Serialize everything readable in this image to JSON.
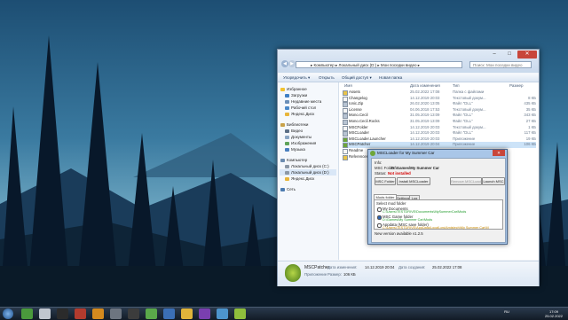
{
  "explorer": {
    "breadcrumb": "▸ Компьютер ▸ Локальный диск (D:) ▸ Мои поседки видео ▸",
    "search_placeholder": "Поиск: Мои поседки видео",
    "toolbar": [
      "Упорядочить ▾",
      "Открыть",
      "Общий доступ ▾",
      "Новая папка"
    ],
    "nav": {
      "favorites": "Избранное",
      "downloads": "Загрузки",
      "recent": "Недавние места",
      "desktop": "Рабочий стол",
      "yandex": "Яндекс.Диск",
      "libraries": "Библиотеки",
      "video": "Видео",
      "documents": "Документы",
      "images": "Изображения",
      "music": "Музыка",
      "computer": "Компьютер",
      "disk_c": "Локальный диск (C:)",
      "disk_d": "Локальный диск (D:)",
      "yandex2": "Яндекс.Диск",
      "network": "Сеть"
    },
    "columns": {
      "name": "Имя",
      "date": "Дата изменения",
      "type": "Тип",
      "size": "Размер"
    },
    "files": [
      {
        "name": "Assets",
        "date": "25.02.2022 17:08",
        "type": "Папка с файлами",
        "size": ""
      },
      {
        "name": "Changelog",
        "date": "14.12.2019 20:03",
        "type": "Текстовый докум...",
        "size": "8 КБ"
      },
      {
        "name": "Ionic.Zip",
        "date": "26.02.2020 13:05",
        "type": "Файл \"DLL\"",
        "size": "435 КБ"
      },
      {
        "name": "License",
        "date": "04.06.2018 17:53",
        "type": "Текстовый докум...",
        "size": "35 КБ"
      },
      {
        "name": "Mono.Cecil",
        "date": "31.05.2019 13:09",
        "type": "Файл \"DLL\"",
        "size": "343 КБ"
      },
      {
        "name": "Mono.Cecil.Rocks",
        "date": "31.05.2019 13:09",
        "type": "Файл \"DLL\"",
        "size": "27 КБ"
      },
      {
        "name": "MSCFolder",
        "date": "14.12.2019 20:03",
        "type": "Текстовый докум...",
        "size": "1 КБ"
      },
      {
        "name": "MSCLoader",
        "date": "14.12.2019 20:03",
        "type": "Файл \"DLL\"",
        "size": "117 КБ"
      },
      {
        "name": "MSCLoader.Launcher",
        "date": "14.12.2019 20:03",
        "type": "Приложение",
        "size": "19 КБ"
      },
      {
        "name": "MSCPatcher",
        "date": "14.12.2019 20:04",
        "type": "Приложение",
        "size": "106 КБ"
      },
      {
        "name": "Readme",
        "date": "",
        "type": "",
        "size": ""
      },
      {
        "name": "References",
        "date": "",
        "type": "",
        "size": ""
      }
    ],
    "details": {
      "name": "MSCPatcher",
      "modified_label": "Дата изменения:",
      "modified": "14.12.2019 20:04",
      "created_label": "Дата создания:",
      "created": "25.02.2022 17:08",
      "type": "Приложение",
      "size_label": "Размер:",
      "size": "106 КБ"
    }
  },
  "dialog": {
    "title": "MSCLoader for My Summer Car",
    "info": "Info:",
    "msc_folder_label": "MSC Folder:",
    "msc_folder": "D:\\Games\\My Summer Car",
    "status_label": "Status:",
    "status": "Not installed",
    "buttons": [
      "MSC Folder",
      "Install MSCLoader",
      "Remove MSCLoader",
      "Launch MSC"
    ],
    "tabs": [
      "Mods folder",
      "Settings",
      "Log"
    ],
    "select_label": "Select mod folder",
    "options": [
      {
        "title": "My Documents",
        "path": "C:\\Users\\TESTDRIVE\\Documents\\MySummerCar\\Mods"
      },
      {
        "title": "MSC Game folder",
        "path": "D:\\Games\\My Summer Car\\Mods"
      },
      {
        "title": "Appdata (MSC save folder)",
        "path": "C:\\Users\\TESTDRIVE\\AppData\\LocalLow\\Amistech\\My Summer Car\\M"
      }
    ],
    "footer": "New version available v1.2.5"
  },
  "taskbar": {
    "lang": "RU",
    "time": "17:09",
    "date": "25.02.2022"
  },
  "colors": {
    "status_red": "#d40000",
    "path_green": "#1f9a2a",
    "taskbar": "#17212d"
  }
}
